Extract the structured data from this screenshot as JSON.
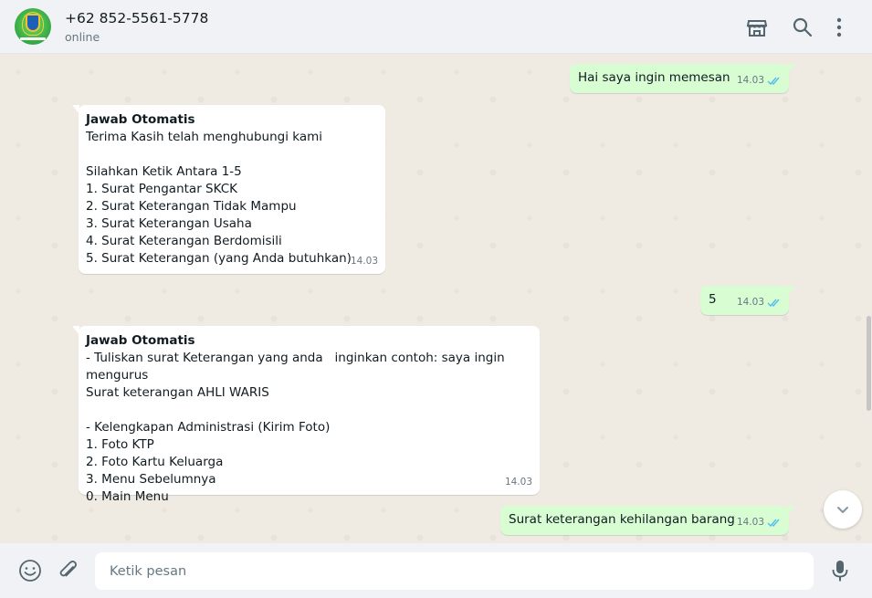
{
  "header": {
    "contact_name": "+62 852-5561-5778",
    "status": "online",
    "icons": [
      "store-icon",
      "search-icon",
      "menu-icon"
    ]
  },
  "messages": [
    {
      "direction": "outgoing",
      "text": "Hai saya ingin memesan",
      "time": "14.03",
      "status": "read"
    },
    {
      "direction": "incoming",
      "title": "Jawab Otomatis",
      "text": "Terima Kasih telah menghubungi kami\n\nSilahkan Ketik Antara 1-5\n1. Surat Pengantar SKCK\n2. Surat Keterangan Tidak Mampu\n3. Surat Keterangan Usaha\n4. Surat Keterangan Berdomisili\n5. Surat Keterangan (yang Anda butuhkan)",
      "time": "14.03"
    },
    {
      "direction": "outgoing",
      "text": "5",
      "time": "14.03",
      "status": "read"
    },
    {
      "direction": "incoming",
      "title": "Jawab Otomatis",
      "text": "- Tuliskan surat Keterangan yang anda   inginkan contoh: saya ingin mengurus\nSurat keterangan AHLI WARIS\n\n- Kelengkapan Administrasi (Kirim Foto)\n1. Foto KTP\n2. Foto Kartu Keluarga\n3. Menu Sebelumnya\n0. Main Menu",
      "time": "14.03"
    },
    {
      "direction": "outgoing",
      "text": "Surat keterangan kehilangan barang",
      "time": "14.03",
      "status": "read"
    }
  ],
  "composer": {
    "placeholder": "Ketik pesan",
    "value": ""
  },
  "colors": {
    "outgoing_bubble": "#d9fdd3",
    "incoming_bubble": "#ffffff",
    "chat_background": "#efeae2",
    "read_ticks": "#53bdeb",
    "header_background": "#f0f2f5"
  }
}
